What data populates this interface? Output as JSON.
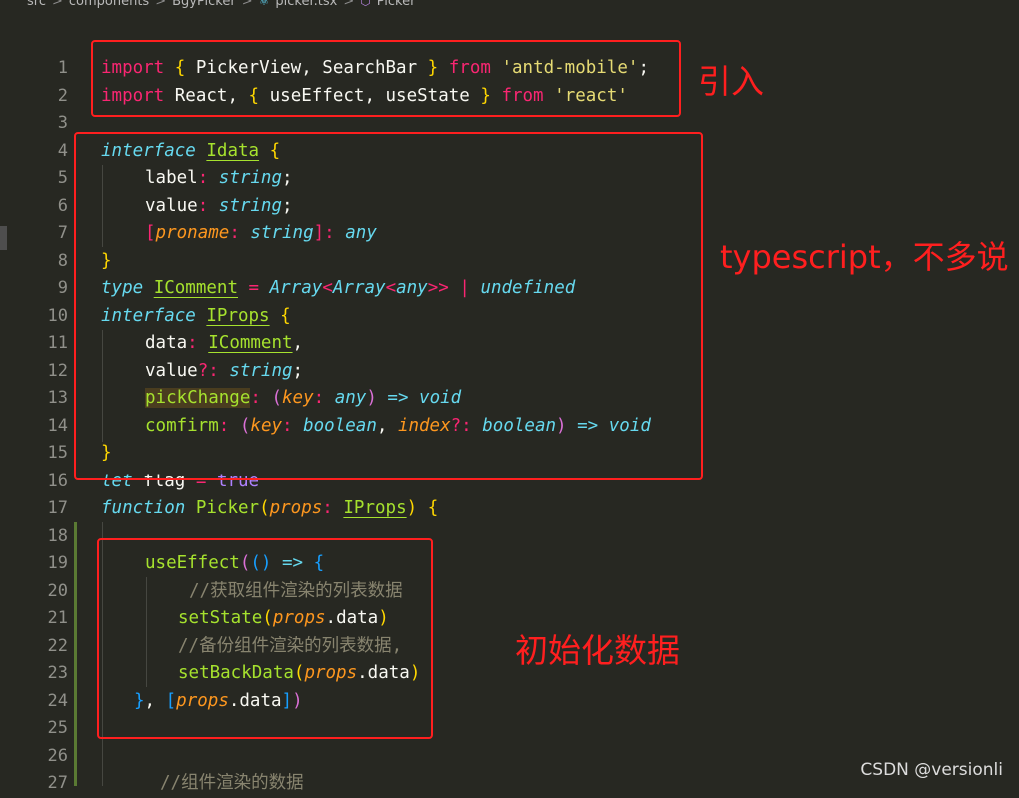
{
  "breadcrumb": {
    "items": [
      "src",
      "components",
      "BgyPicker",
      "picker.tsx",
      "Picker"
    ],
    "separator": ">"
  },
  "code_lines": [
    "1",
    "2",
    "3",
    "4",
    "5",
    "6",
    "7",
    "8",
    "9",
    "10",
    "11",
    "12",
    "13",
    "14",
    "15",
    "16",
    "17",
    "18",
    "19",
    "20",
    "21",
    "22",
    "23",
    "24",
    "25",
    "26",
    "27"
  ],
  "annotations": {
    "import_note": "引入",
    "ts_note": "typescript，不多说",
    "init_note": "初始化数据"
  },
  "watermark": "CSDN @versionli",
  "colors": {
    "background": "#272822",
    "keyword": "#f92672",
    "string": "#e6db74",
    "type": "#66d9ef",
    "function": "#a6e22e",
    "parameter": "#fd971f",
    "comment": "#88846f",
    "annotation_red": "#ff1f1f"
  },
  "code": {
    "l1": [
      "import",
      "{",
      "PickerView, SearchBar",
      "}",
      "from",
      "'antd-mobile'",
      ";"
    ],
    "l2": [
      "import",
      "React, ",
      "{",
      "useEffect, useState",
      "}",
      "from",
      "'react'"
    ],
    "l4": [
      "interface",
      "Idata",
      "{"
    ],
    "l5": [
      "label",
      ":",
      "string",
      ";"
    ],
    "l6": [
      "value",
      ":",
      "string",
      ";"
    ],
    "l7": [
      "[",
      "proname",
      ":",
      "string",
      "]",
      ":",
      "any"
    ],
    "l8": [
      "}"
    ],
    "l9": [
      "type",
      "IComment",
      "=",
      "Array",
      "<",
      "Array",
      "<",
      "any",
      ">>",
      "|",
      "undefined"
    ],
    "l10": [
      "interface",
      "IProps",
      "{"
    ],
    "l11": [
      "data",
      ":",
      "IComment",
      ","
    ],
    "l12": [
      "value",
      "?:",
      "string",
      ";"
    ],
    "l13": [
      "pickChange",
      ":",
      "(",
      "key",
      ":",
      "any",
      ")",
      "=>",
      "void"
    ],
    "l14": [
      "comfirm",
      ":",
      "(",
      "key",
      ":",
      "boolean",
      ", ",
      "index",
      "?:",
      "boolean",
      ")",
      "=>",
      "void"
    ],
    "l15": [
      "}"
    ],
    "l16": [
      "let",
      "flag",
      "=",
      "true"
    ],
    "l17": [
      "function",
      "Picker",
      "(",
      "props",
      ":",
      "IProps",
      ")",
      "{"
    ],
    "l19": [
      "useEffect",
      "(",
      "()",
      "=>",
      "{"
    ],
    "l20": "//获取组件渲染的列表数据",
    "l21": [
      "setState",
      "(",
      "props",
      ".data",
      ")"
    ],
    "l22": "//备份组件渲染的列表数据,",
    "l23": [
      "setBackData",
      "(",
      "props",
      ".data",
      ")"
    ],
    "l24": [
      "}",
      ", ",
      "[",
      "props",
      ".data",
      "]",
      ")"
    ],
    "l27": "//组件渲染的数据"
  }
}
